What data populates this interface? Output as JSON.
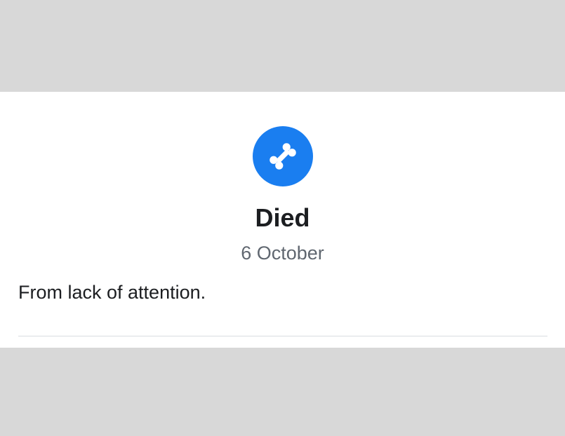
{
  "life_event": {
    "icon": "bone-icon",
    "title": "Died",
    "date": "6 October",
    "description": "From lack of attention."
  },
  "colors": {
    "accent": "#1a7ef0",
    "title_text": "#1c1e21",
    "secondary_text": "#606770",
    "background": "#d8d8d8",
    "card": "#ffffff",
    "divider": "#dadde1"
  }
}
